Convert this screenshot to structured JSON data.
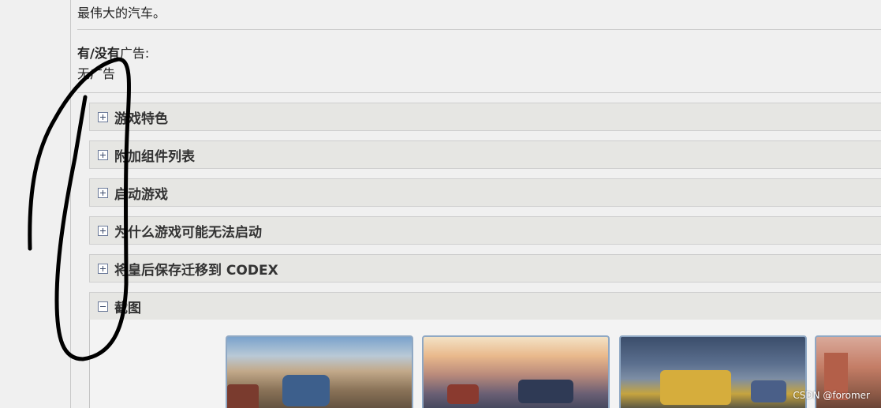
{
  "intro": {
    "text": "最伟大的汽车。"
  },
  "ads": {
    "label_bold": "有/没有",
    "label_rest": "广告:",
    "value": "无广告"
  },
  "sections": [
    {
      "label": "游戏特色",
      "state": "collapsed"
    },
    {
      "label": "附加组件列表",
      "state": "collapsed"
    },
    {
      "label": "启动游戏",
      "state": "collapsed"
    },
    {
      "label": "为什么游戏可能无法启动",
      "state": "collapsed"
    },
    {
      "label": "将皇后保存迁移到 CODEX",
      "state": "collapsed"
    },
    {
      "label": "截图",
      "state": "expanded"
    }
  ],
  "screenshots": {
    "count_visible": 4
  },
  "watermark": {
    "text": "CSDN @foromer"
  },
  "colors": {
    "section_bg": "#e6e6e3",
    "page_bg": "#f0f0f0",
    "thumb_border": "#8fa8c4",
    "annotation_ink": "#000000"
  }
}
